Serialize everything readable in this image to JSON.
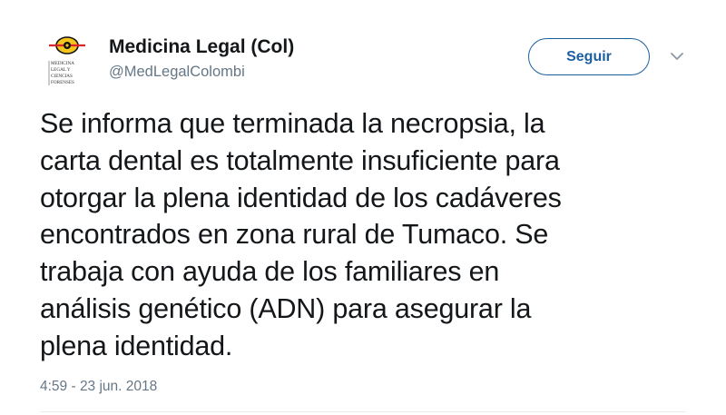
{
  "author": {
    "name": "Medicina Legal (Col)",
    "handle": "@MedLegalColombi",
    "avatar": {
      "logo_lines": [
        "MEDICINA",
        "LEGAL Y",
        "CIENCIAS",
        "FORENSES"
      ],
      "colors": {
        "yellow": "#f4c51b",
        "red": "#d8262b",
        "black": "#111111"
      }
    }
  },
  "follow_button": {
    "label": "Seguir"
  },
  "menu": {
    "icon": "chevron-down-icon"
  },
  "tweet": {
    "lines": [
      "Se informa que terminada la necropsia, la",
      "carta dental es totalmente insuficiente para",
      "otorgar la plena identidad de los cadáveres",
      "encontrados en zona rural de Tumaco. Se",
      "trabaja con ayuda de los familiares en",
      "análisis genético (ADN) para asegurar la",
      "plena identidad."
    ]
  },
  "timestamp": "4:59 - 23 jun. 2018",
  "colors": {
    "accent": "#1c5fa0",
    "text": "#14171a",
    "secondary_text": "#657786",
    "divider": "#e6ecf0"
  }
}
